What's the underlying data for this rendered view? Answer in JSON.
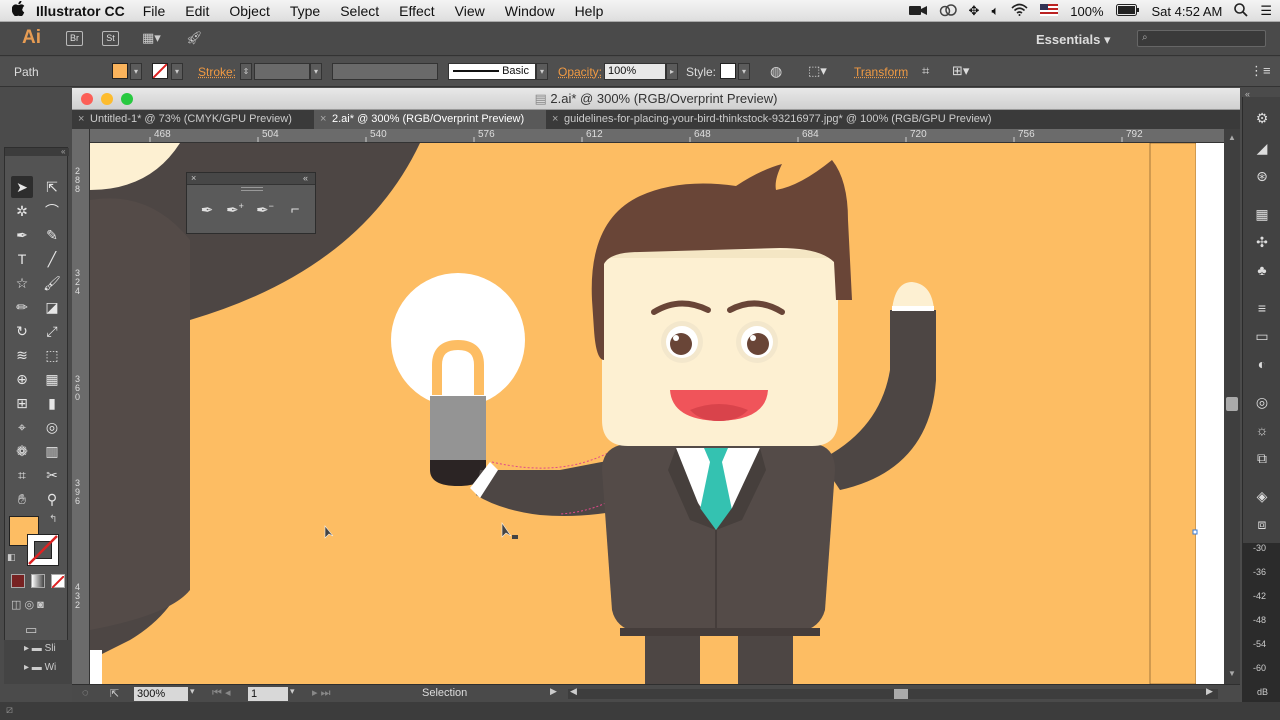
{
  "menubar": {
    "apple": "",
    "app_name": "Illustrator CC",
    "items": [
      "File",
      "Edit",
      "Object",
      "Type",
      "Select",
      "Effect",
      "View",
      "Window",
      "Help"
    ],
    "battery": "100%",
    "clock": "Sat 4:52 AM"
  },
  "appbar": {
    "logo": "Ai",
    "bridge": "Br",
    "stock": "St",
    "workspace": "Essentials",
    "workspace_arrow": "▾"
  },
  "control": {
    "selection_type": "Path",
    "stroke_label": "Stroke:",
    "brush": "Basic",
    "opacity_label": "Opacity:",
    "opacity_value": "100%",
    "style_label": "Style:",
    "transform_link": "Transform",
    "fill_color": "#fbb45c"
  },
  "document": {
    "title": "2.ai* @ 300% (RGB/Overprint Preview)",
    "tabs": [
      {
        "label": "Untitled-1* @ 73% (CMYK/GPU Preview)",
        "active": false
      },
      {
        "label": "2.ai* @ 300% (RGB/Overprint Preview)",
        "active": true
      },
      {
        "label": "guidelines-for-placing-your-bird-thinkstock-93216977.jpg* @ 100% (RGB/GPU Preview)",
        "active": false
      }
    ],
    "ruler_h": [
      "468",
      "504",
      "540",
      "576",
      "612",
      "648",
      "684",
      "720",
      "756",
      "792"
    ],
    "ruler_v": [
      "288",
      "324",
      "360",
      "396",
      "432"
    ],
    "right_ruler": [
      "-30",
      "-36",
      "-42",
      "-48",
      "-54",
      "-60",
      "dB"
    ]
  },
  "status": {
    "zoom": "300%",
    "artboard": "1",
    "tool_name": "Selection"
  },
  "colors": {
    "artboard_bg": "#fdbd63",
    "suit": "#544b48",
    "skin": "#fdf0d2",
    "hair": "#694537",
    "tie": "#34c2b1",
    "mouth": "#f0545a",
    "selection": "#e0498a"
  },
  "icons": {
    "pen_panel": [
      "pen-icon",
      "add-anchor-point-icon",
      "delete-anchor-point-icon",
      "anchor-point-icon"
    ]
  }
}
